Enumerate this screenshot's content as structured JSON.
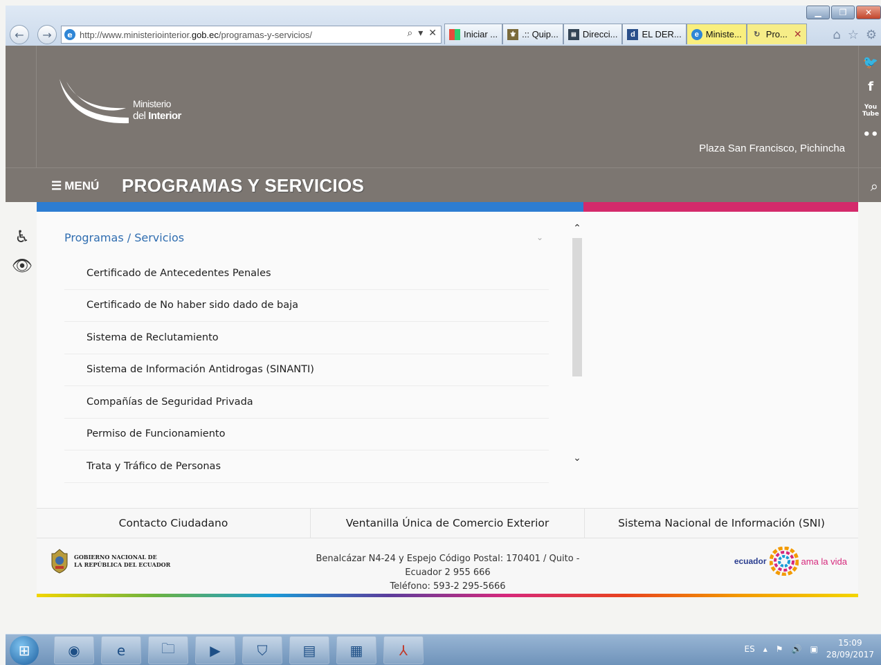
{
  "browser": {
    "url_prefix": "http://www.ministeriointerior.",
    "url_domain": "gob.ec",
    "url_path": "/programas-y-servicios/",
    "tabs": [
      {
        "label": "Iniciar ...",
        "icon": "windows-icon",
        "active": false
      },
      {
        "label": ".:: Quip...",
        "icon": "crest-icon",
        "active": false
      },
      {
        "label": "Direcci...",
        "icon": "page-icon",
        "active": false
      },
      {
        "label": "EL DER...",
        "icon": "d-icon",
        "active": false
      },
      {
        "label": "Ministe...",
        "icon": "ie-icon",
        "active": true
      },
      {
        "label": "Pro...",
        "icon": "loading-icon",
        "active": false
      }
    ]
  },
  "header": {
    "logo_line1": "Ministerio",
    "logo_line2_prefix": "del ",
    "logo_line2_bold": "Interior",
    "location": "Plaza San Francisco, Pichincha",
    "menu_label": "MENÚ",
    "page_title": "PROGRAMAS Y SERVICIOS"
  },
  "content": {
    "breadcrumb": "Programas / Servicios",
    "items": [
      "Certificado de Antecedentes Penales",
      "Certificado de No haber sido dado de baja",
      "Sistema de Reclutamiento",
      "Sistema de Información Antidrogas (SINANTI)",
      "Compañías de Seguridad Privada",
      "Permiso de Funcionamiento",
      "Trata y Tráfico de Personas"
    ]
  },
  "links": [
    "Contacto Ciudadano",
    "Ventanilla Única de Comercio Exterior",
    "Sistema Nacional de Información (SNI)"
  ],
  "footer": {
    "gov_line1": "GOBIERNO NACIONAL DE",
    "gov_line2": "LA REPÚBLICA DEL ECUADOR",
    "address_line1": "Benalcázar N4-24 y Espejo Código Postal: 170401 / Quito -",
    "address_line2": "Ecuador 2 955 666",
    "address_line3": "Teléfono: 593-2 295-5666",
    "brand_word1": "ecuador",
    "brand_word2": "ama la vida"
  },
  "taskbar": {
    "lang": "ES",
    "time": "15:09",
    "date": "28/09/2017"
  },
  "colors": {
    "header_bg": "#7c7671",
    "accent_blue": "#2d7dd2",
    "accent_pink": "#d42a6b",
    "link_blue": "#2f6db0"
  }
}
